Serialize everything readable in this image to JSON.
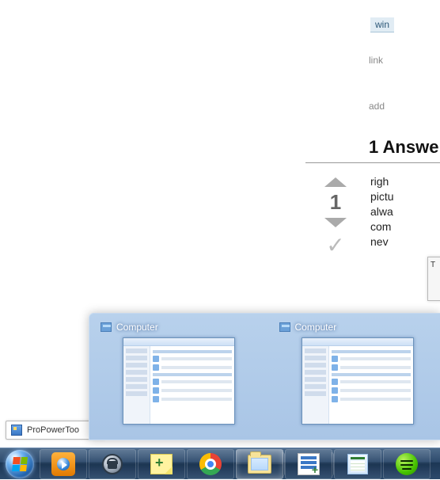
{
  "page": {
    "tag_fragment": "win",
    "link_text": "link",
    "add_text": "add",
    "answers_header": "1 Answe",
    "vote_score": "1",
    "answer_lines": [
      "righ",
      "pictu",
      "alwa",
      "com",
      "nev"
    ],
    "floating_box": "T"
  },
  "tooltip": {
    "label": "ProPowerToo"
  },
  "preview": {
    "items": [
      {
        "title": "Computer"
      },
      {
        "title": "Computer"
      }
    ]
  },
  "taskbar": {
    "buttons": [
      {
        "name": "media-player",
        "active": false,
        "stack": false
      },
      {
        "name": "encryption",
        "active": false,
        "stack": false
      },
      {
        "name": "sticky-notes",
        "active": false,
        "stack": false
      },
      {
        "name": "chrome",
        "active": false,
        "stack": false
      },
      {
        "name": "file-explorer",
        "active": true,
        "stack": true
      },
      {
        "name": "text-editor",
        "active": false,
        "stack": true
      },
      {
        "name": "spreadsheet",
        "active": false,
        "stack": false
      },
      {
        "name": "music-player",
        "active": false,
        "stack": false
      }
    ]
  }
}
